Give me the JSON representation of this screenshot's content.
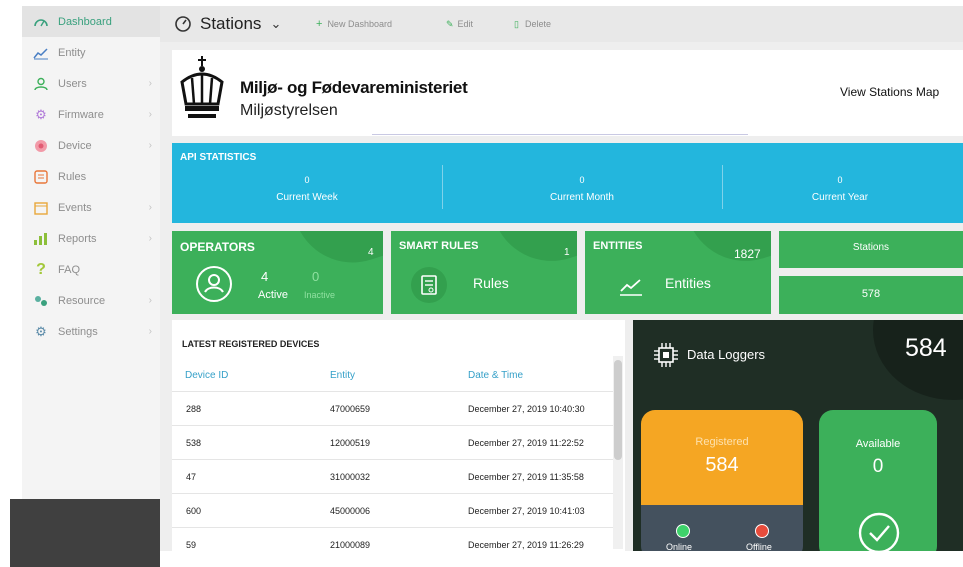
{
  "colors": {
    "accent_green": "#3cb05a",
    "api_blue": "#23b6dd",
    "registered_orange": "#f5a623",
    "online_green": "#3ed36b",
    "offline_red": "#e74c3c"
  },
  "sidebar": {
    "items": [
      {
        "label": "Dashboard",
        "icon": "dashboard-icon",
        "active": true
      },
      {
        "label": "Entity",
        "icon": "line-chart-icon"
      },
      {
        "label": "Users",
        "icon": "user-icon"
      },
      {
        "label": "Firmware",
        "icon": "gear-icon"
      },
      {
        "label": "Device",
        "icon": "device-icon"
      },
      {
        "label": "Rules",
        "icon": "rules-icon"
      },
      {
        "label": "Events",
        "icon": "calendar-icon"
      },
      {
        "label": "Reports",
        "icon": "bar-chart-icon"
      },
      {
        "label": "FAQ",
        "icon": "question-icon"
      },
      {
        "label": "Resource",
        "icon": "resource-icon"
      },
      {
        "label": "Settings",
        "icon": "settings-icon"
      }
    ]
  },
  "topbar": {
    "dashboard_name": "Stations",
    "new_dashboard": "New Dashboard",
    "edit": "Edit",
    "delete": "Delete"
  },
  "header": {
    "org_name": "Miljø- og Fødevareministeriet",
    "org_sub": "Miljøstyrelsen",
    "view_map": "View Stations Map"
  },
  "api_stats": {
    "title": "API STATISTICS",
    "week_value": "0",
    "week_label": "Current Week",
    "month_value": "0",
    "month_label": "Current Month",
    "year_value": "0",
    "year_label": "Current Year"
  },
  "operators": {
    "title": "OPERATORS",
    "total": "4",
    "active_value": "4",
    "active_label": "Active",
    "inactive_value": "0",
    "inactive_label": "Inactive"
  },
  "smart_rules": {
    "title": "SMART RULES",
    "total": "1",
    "label": "Rules"
  },
  "entities": {
    "title": "ENTITIES",
    "total": "1827",
    "label": "Entities"
  },
  "stations": {
    "title": "Stations",
    "value": "578"
  },
  "devices": {
    "title": "LATEST REGISTERED DEVICES",
    "columns": [
      "Device ID",
      "Entity",
      "Date & Time"
    ],
    "rows": [
      [
        "288",
        "47000659",
        "December 27, 2019 10:40:30"
      ],
      [
        "538",
        "12000519",
        "December 27, 2019 11:22:52"
      ],
      [
        "47",
        "31000032",
        "December 27, 2019 11:35:58"
      ],
      [
        "600",
        "45000006",
        "December 27, 2019 10:41:03"
      ],
      [
        "59",
        "21000089",
        "December 27, 2019 11:26:29"
      ]
    ]
  },
  "loggers": {
    "title": "Data Loggers",
    "total": "584",
    "registered_label": "Registered",
    "registered_value": "584",
    "available_label": "Available",
    "available_value": "0",
    "online_label": "Online",
    "offline_label": "Offline"
  }
}
